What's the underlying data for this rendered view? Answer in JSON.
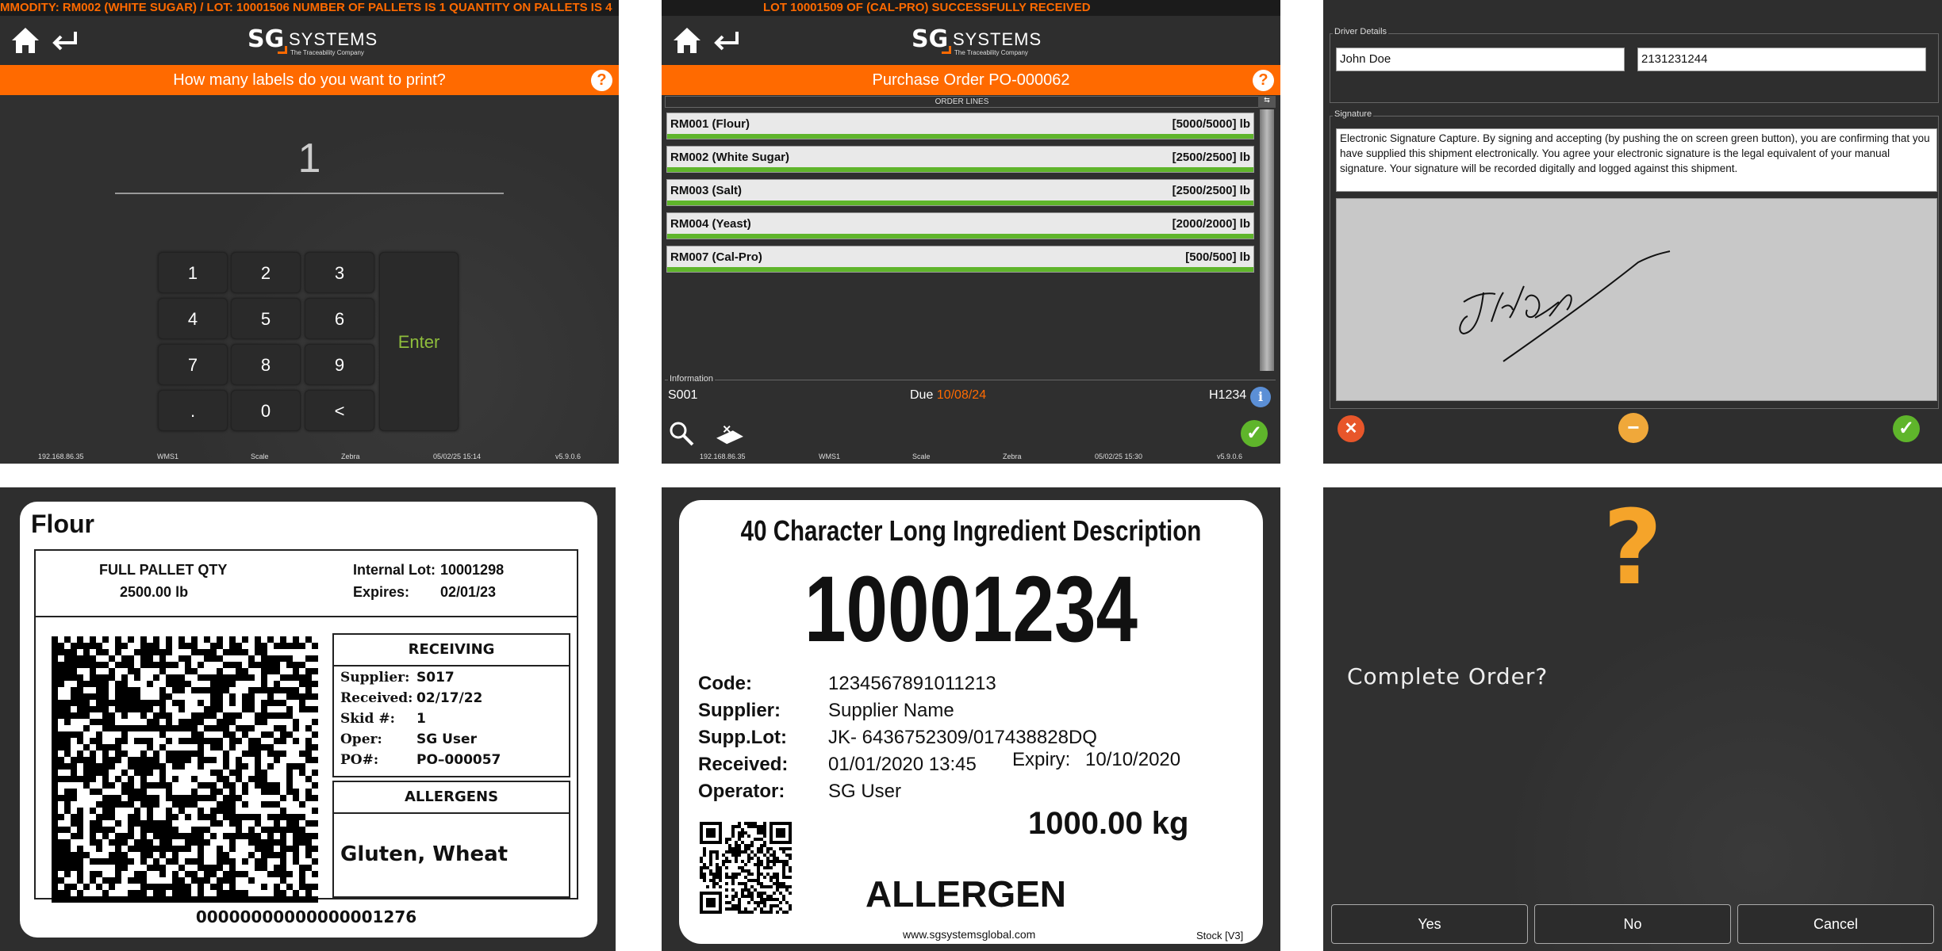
{
  "panel1": {
    "ticker": "MMODITY: RM002 (WHITE SUGAR) / LOT: 10001506 NUMBER OF PALLETS IS 1 QUANTITY ON PALLETS IS 4",
    "logo_sg": "SG",
    "logo_systems": "SYSTEMS",
    "logo_tag": "The Traceability Company",
    "prompt": "How many labels do you want to print?",
    "help": "?",
    "value": "1",
    "keys": [
      "1",
      "2",
      "3",
      "4",
      "5",
      "6",
      "7",
      "8",
      "9",
      ".",
      "0",
      "<"
    ],
    "enter": "Enter",
    "status": [
      "192.168.86.35",
      "WMS1",
      "Scale",
      "Zebra",
      "05/02/25 15:14",
      "v5.9.0.6"
    ]
  },
  "panel2": {
    "ticker": "LOT 10001509 OF (CAL-PRO) SUCCESSFULLY RECEIVED",
    "title": "Purchase Order PO-000062",
    "help": "?",
    "order_lines_header": "ORDER LINES",
    "lines": [
      {
        "name": "RM001 (Flour)",
        "qty": "[5000/5000] lb"
      },
      {
        "name": "RM002 (White Sugar)",
        "qty": "[2500/2500] lb"
      },
      {
        "name": "RM003 (Salt)",
        "qty": "[2500/2500] lb"
      },
      {
        "name": "RM004 (Yeast)",
        "qty": "[2000/2000] lb"
      },
      {
        "name": "RM007 (Cal-Pro)",
        "qty": "[500/500] lb"
      }
    ],
    "info_label": "Information",
    "supplier": "S001",
    "due_label": "Due",
    "due_date": "10/08/24",
    "ref": "H1234",
    "status": [
      "192.168.86.35",
      "WMS1",
      "Scale",
      "Zebra",
      "05/02/25 15:30",
      "v5.9.0.6"
    ]
  },
  "panel3": {
    "driver_label": "Driver Details",
    "driver_name": "John Doe",
    "driver_phone": "2131231244",
    "signature_label": "Signature",
    "signature_text": "Electronic Signature Capture. By signing and accepting (by pushing the on screen green button), you are confirming that you have supplied this shipment electronically. You agree your electronic signature is the legal equivalent of your manual signature. Your signature will be recorded digitally and logged against this shipment."
  },
  "panel4": {
    "title": "Flour",
    "full_pallet": "FULL PALLET QTY",
    "pallet_qty": "2500.00 lb",
    "internal_lot_label": "Internal Lot:",
    "internal_lot": "10001298",
    "expires_label": "Expires:",
    "expires": "02/01/23",
    "receiving": "RECEIVING",
    "rows": [
      {
        "k": "Supplier:",
        "v": "S017"
      },
      {
        "k": "Received:",
        "v": "02/17/22"
      },
      {
        "k": "Skid #:",
        "v": "1"
      },
      {
        "k": "Oper:",
        "v": "SG User"
      },
      {
        "k": "PO#:",
        "v": "PO–000057"
      }
    ],
    "allergens": "ALLERGENS",
    "allergen_list": "Gluten, Wheat",
    "barcode_text": "00000000000000001276"
  },
  "panel5": {
    "title": "40 Character Long Ingredient Description",
    "big_number": "10001234",
    "fields": [
      {
        "k": "Code:",
        "v": "1234567891011213"
      },
      {
        "k": "Supplier:",
        "v": "Supplier Name"
      },
      {
        "k": "Supp.Lot:",
        "v": "JK-  6436752309/017438828DQ"
      },
      {
        "k": "Received:",
        "v": "01/01/2020 13:45"
      },
      {
        "k": "Operator:",
        "v": "SG User"
      }
    ],
    "expiry_label": "Expiry:",
    "expiry": "10/10/2020",
    "weight": "1000.00 kg",
    "allergen": "ALLERGEN",
    "website": "www.sgsystemsglobal.com",
    "stock": "Stock [V3]"
  },
  "panel6": {
    "question_mark": "?",
    "prompt": "Complete Order?",
    "yes": "Yes",
    "no": "No",
    "cancel": "Cancel"
  },
  "colors": {
    "accent": "#ff6a00",
    "success": "#5fb52b",
    "bg": "#313131"
  }
}
